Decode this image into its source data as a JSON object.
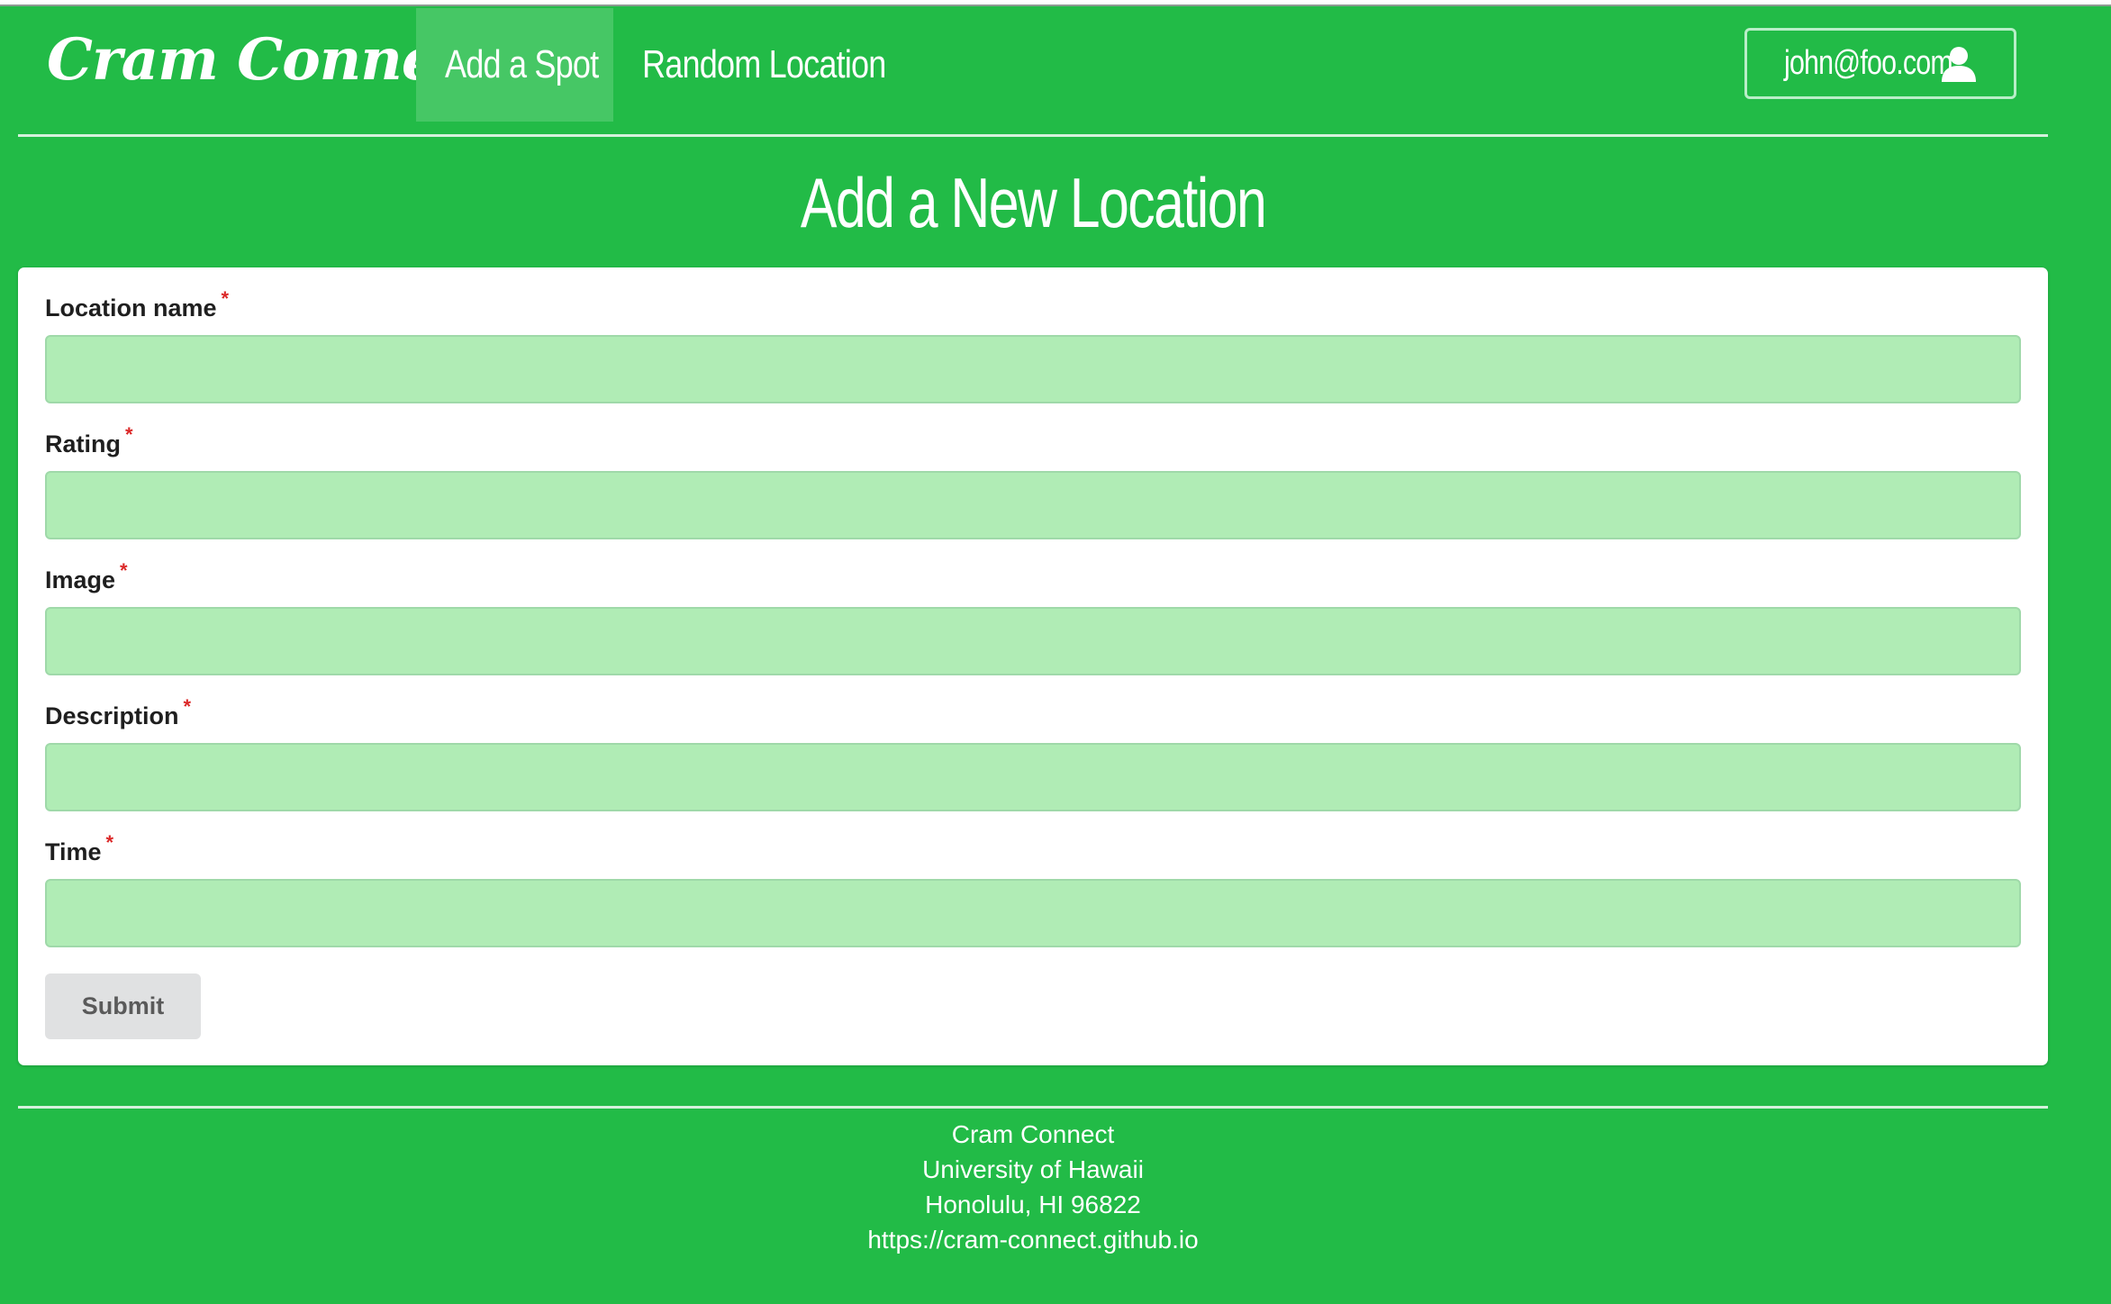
{
  "colors": {
    "brand_green": "#22bb47",
    "active_nav": "#46c765",
    "input_fill": "#b0ecb5",
    "required_star": "#db2828",
    "submit_bg": "#e0e1e2"
  },
  "navbar": {
    "brand": "Cram Connect",
    "items": [
      {
        "label": "Add a Spot",
        "active": true
      },
      {
        "label": "Random Location",
        "active": false
      }
    ],
    "user": {
      "email": "john@foo.com",
      "icon": "user-icon"
    }
  },
  "page": {
    "title": "Add a New Location"
  },
  "form": {
    "required_marker": "*",
    "fields": [
      {
        "label": "Location name",
        "value": ""
      },
      {
        "label": "Rating",
        "value": ""
      },
      {
        "label": "Image",
        "value": ""
      },
      {
        "label": "Description",
        "value": ""
      },
      {
        "label": "Time",
        "value": ""
      }
    ],
    "submit_label": "Submit"
  },
  "footer": {
    "lines": [
      "Cram Connect",
      "University of Hawaii",
      "Honolulu, HI 96822",
      "https://cram-connect.github.io"
    ]
  }
}
